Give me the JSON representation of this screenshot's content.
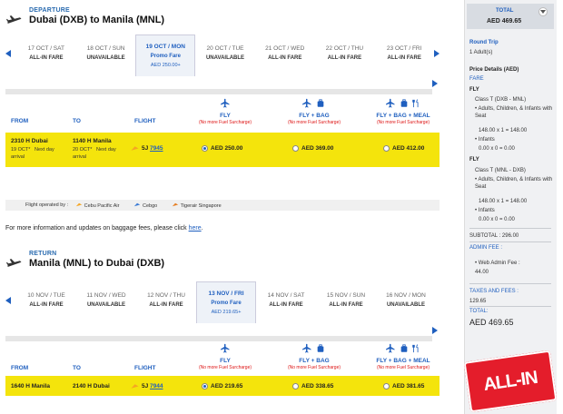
{
  "departure": {
    "label": "DEPARTURE",
    "route": "Dubai (DXB) to Manila (MNL)",
    "dates": [
      {
        "date": "17 OCT / SAT",
        "fare": "ALL-IN FARE",
        "price": ""
      },
      {
        "date": "18 OCT / SUN",
        "fare": "UNAVAILABLE",
        "price": ""
      },
      {
        "date": "19 OCT / MON",
        "fare": "Promo Fare",
        "price": "AED 250.00+"
      },
      {
        "date": "20 OCT / TUE",
        "fare": "UNAVAILABLE",
        "price": ""
      },
      {
        "date": "21 OCT / WED",
        "fare": "ALL-IN FARE",
        "price": ""
      },
      {
        "date": "22 OCT / THU",
        "fare": "ALL-IN FARE",
        "price": ""
      },
      {
        "date": "23 OCT / FRI",
        "fare": "ALL-IN FARE",
        "price": ""
      }
    ],
    "row": {
      "from_time": "2310 H Dubai",
      "from_sub": "19 OCT*",
      "from_sub2": "arrival",
      "next_day": "Next day",
      "to_time": "1140 H Manila",
      "to_sub": "20 OCT*",
      "to_next": "Next day",
      "to_sub2": "arrival",
      "flight_prefix": "5J",
      "flight_no": "7945",
      "fly": "AED 250.00",
      "bag": "AED 369.00",
      "meal": "AED 412.00"
    }
  },
  "return": {
    "label": "RETURN",
    "route": "Manila (MNL) to Dubai (DXB)",
    "dates": [
      {
        "date": "10 NOV / TUE",
        "fare": "ALL-IN FARE",
        "price": ""
      },
      {
        "date": "11 NOV / WED",
        "fare": "UNAVAILABLE",
        "price": ""
      },
      {
        "date": "12 NOV / THU",
        "fare": "ALL-IN FARE",
        "price": ""
      },
      {
        "date": "13 NOV / FRI",
        "fare": "Promo Fare",
        "price": "AED 219.65+"
      },
      {
        "date": "14 NOV / SAT",
        "fare": "ALL-IN FARE",
        "price": ""
      },
      {
        "date": "15 NOV / SUN",
        "fare": "ALL-IN FARE",
        "price": ""
      },
      {
        "date": "16 NOV / MON",
        "fare": "UNAVAILABLE",
        "price": ""
      }
    ],
    "row": {
      "from_time": "1640 H Manila",
      "to_time": "2140 H Dubai",
      "flight_prefix": "5J",
      "flight_no": "7944",
      "fly": "AED 219.65",
      "bag": "AED 338.65",
      "meal": "AED 381.65"
    }
  },
  "columns": {
    "from": "FROM",
    "to": "TO",
    "flight": "FLIGHT",
    "fly": "FLY",
    "bag": "FLY + BAG",
    "meal": "FLY + BAG + MEAL",
    "note": "(No more Fuel Surcharge)"
  },
  "operated": {
    "label": "Flight operated by :",
    "carriers": [
      "Cebu Pacific Air",
      "Cebgo",
      "Tigerair Singapore"
    ]
  },
  "moreinfo": {
    "text": "For more information and updates on baggage fees, please click ",
    "link": "here",
    "end": "."
  },
  "sidebar": {
    "total_label": "TOTAL",
    "total_value": "AED 469.65",
    "trip_label": "Round Trip",
    "adults": "1 Adult(s)",
    "price_details": "Price Details (AED)",
    "fare": "FARE",
    "fly1": "FLY",
    "class1": "Class T (DXB - MNL)",
    "pax1": "Adults, Children, & Infants with Seat",
    "calc1": "148.00 x 1 = 148.00",
    "inf1": "Infants",
    "inf1calc": "0.00 x 0 = 0.00",
    "fly2": "FLY",
    "class2": "Class T (MNL - DXB)",
    "pax2": "Adults, Children, & Infants with Seat",
    "calc2": "148.00 x 1 = 148.00",
    "inf2": "Infants",
    "inf2calc": "0.00 x 0 = 0.00",
    "subtotal": "SUBTOTAL : 296.00",
    "admin_label": "ADMIN FEE :",
    "admin_item": "Web Admin Fee :",
    "admin_value": "44.00",
    "taxes_label": "TAXES AND FEES :",
    "taxes_value": "129.65",
    "total2_label": "TOTAL:",
    "total2_value": "AED 469.65"
  },
  "badge": "ALL-IN",
  "colors": {
    "accent": "#1f5fbf",
    "highlight": "#f4e40c",
    "badge": "#e41d2b",
    "surcharge": "#dd1111"
  }
}
